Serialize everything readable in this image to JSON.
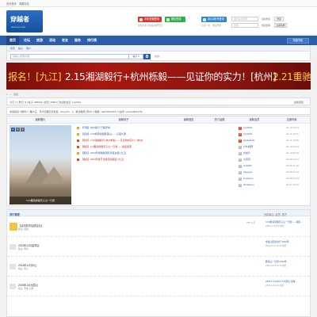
{
  "topbar": {
    "left_links": [
      "设为首页",
      "收藏本站"
    ]
  },
  "header": {
    "logo_text": "穿越者",
    "logo_sub": "www.cyz.com",
    "btn_phone": "手机快捷登录",
    "btn_wechat": "微信登录",
    "btn_qq": "用QQ帐号登录",
    "sub_phone": "使用手机号快速注册登录",
    "sub_qq": "只需一步，快速开始",
    "login": {
      "user_placeholder": "用户名/手机号",
      "pass_placeholder": "密码",
      "autologin": "自动登录",
      "forgot": "找回密码",
      "login_btn": "登录",
      "register_btn": "立即注册"
    }
  },
  "nav": {
    "items": [
      "首页",
      "论坛",
      "旅游",
      "活动",
      "老友",
      "服务",
      "排行榜"
    ],
    "quick": "快捷导航"
  },
  "subnav": {
    "links": [
      "搜索",
      "帖子",
      "用户"
    ]
  },
  "search": {
    "placeholder": "请输入搜索内容",
    "category": "帖子",
    "hot_label": "热搜:"
  },
  "banner": {
    "seg1": "报名！[九江]",
    "seg2": "2.15湘湖毅行+杭州栎毅——见证你的实力！[杭州]",
    "seg3": "2.21重驰"
  },
  "breadcrumb": {
    "items": [
      "›",
      "论坛"
    ]
  },
  "stats": {
    "text": "今日: 0 | 昨日: 8 | 帖子: 484623 | 会员: 20504 | 欢迎新会员: zyz2019",
    "right": "最新回复"
  },
  "friends": {
    "text": "友情链接: [规则] 1. 雁户庄、苏州玉器定点批发 : shcyy/fm、2、敬请期待 [苏州] / [客服 / qq674841016] / [在线 / wanm3951376] ..."
  },
  "portal": {
    "headers": {
      "images": "最新图片",
      "latest": "最新帖子",
      "new_reply": "最新回复",
      "hot": "热门话题",
      "members": "最新会员",
      "joined": "注册时间"
    },
    "photo_caption": "3.21雁荡穿越天子山一日游",
    "photo_pages": [
      "1",
      "2",
      "3"
    ],
    "latest_posts": [
      "【行程】杭州毅行 行程安排",
      "【活动】3.29皖南穿越醉美山——汉语大课",
      "【徒步】2.15湘湖毅行+杭州栎毅——见证你的实力！[杭州]",
      "【报名】3.2雁荡穿越天子山一日游——报名结束",
      "【团队】2024年穿越者团队年度总结 [九江]",
      "【报名】2024年春节出游活动报名 [九江]"
    ],
    "members": [
      {
        "name": "zyz2019",
        "date": "02-12 09:04"
      },
      {
        "name": "zyz1019",
        "date": "02-11 16:51"
      },
      {
        "name": "gwdy2019",
        "date": "02-11 10:08"
      },
      {
        "name": "户外视野",
        "date": "02-10 20:24"
      },
      {
        "name": "长峰行",
        "date": "02-10 09:36"
      },
      {
        "name": "九风风",
        "date": "02-09 16:22"
      },
      {
        "name": "wx1020",
        "date": "02-09 11:18"
      },
      {
        "name": "papayas",
        "date": "02-08 21:46"
      },
      {
        "name": "linuxkyou",
        "date": "02-08 10:03"
      },
      {
        "name": "hhxdweon",
        "date": "02-07 15:40"
      }
    ]
  },
  "forum_section": {
    "title": "穿行管理",
    "right": "分区版主: 会员, 官方"
  },
  "forums": [
    {
      "title": "【活动发布及报名区】",
      "mod": "版主: 领航",
      "count": "375 / 1万",
      "last": "3.21雁荡穿越天子山一日游——报名...",
      "last_time": "2025-2-3 18:25 秘密"
    },
    {
      "title": "2024年12月金童区",
      "mod": "版主: 明哲",
      "count": "",
      "last": "金童山区新出行 2024年...",
      "last_time": "2024-12-27 07:56 秘密"
    },
    {
      "title": "2024年12月补山",
      "mod": "版主: 黄子",
      "count": "",
      "last": "雁荡山一日游 2024年...",
      "last_time": "2024-12-25 19:16 秘密"
    },
    {
      "title": "2025年1月大围山",
      "mod": "版主: 老鲍  小鹰",
      "count": "",
      "last": "2025.1.3-2025.1.5大围山 穿越...",
      "last_time": "2025-1-6 10:12 秘密"
    }
  ]
}
